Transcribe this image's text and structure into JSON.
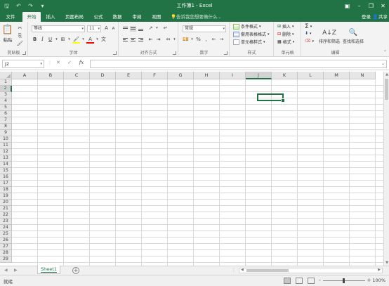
{
  "titlebar": {
    "title": "工作簿1 - Excel",
    "qat": [
      "save-icon",
      "undo-icon",
      "redo-icon",
      "customize-icon"
    ],
    "window_buttons": [
      "ribbon-display-icon",
      "minimize-icon",
      "restore-icon",
      "close-icon"
    ]
  },
  "tabs": {
    "file": "文件",
    "home": "开始",
    "insert": "插入",
    "page_layout": "页面布局",
    "formulas": "公式",
    "data": "数据",
    "review": "审阅",
    "view": "视图",
    "tell_me": "告诉我您想要做什么...",
    "sign_in": "登录",
    "share": "共享"
  },
  "ribbon": {
    "clipboard": {
      "paste": "粘贴",
      "label": "剪贴板"
    },
    "font": {
      "name": "等线",
      "size": "11",
      "label": "字体",
      "bold": "B",
      "italic": "I",
      "underline": "U",
      "font_color_letter": "A",
      "grow": "A",
      "shrink": "A",
      "fill_color": "#ffff00",
      "text_color": "#ff0000"
    },
    "alignment": {
      "label": "对齐方式"
    },
    "number": {
      "format": "常规",
      "label": "数字",
      "percent": "%",
      "comma": ","
    },
    "styles": {
      "conditional": "条件格式",
      "table": "套用表格格式",
      "cell": "单元格样式",
      "label": "样式"
    },
    "cells": {
      "insert": "插入",
      "delete": "删除",
      "format": "格式",
      "label": "单元格"
    },
    "editing": {
      "sum_symbol": "Σ",
      "sort_filter": "排序和筛选",
      "find_select": "查找和选择",
      "label": "编辑"
    }
  },
  "formula_bar": {
    "name_box": "J2",
    "fx": "fx",
    "cancel": "✕",
    "enter": "✓",
    "value": ""
  },
  "grid": {
    "columns": [
      "A",
      "B",
      "C",
      "D",
      "E",
      "F",
      "G",
      "H",
      "I",
      "J",
      "K",
      "L",
      "M",
      "N"
    ],
    "rows": [
      "1",
      "2",
      "3",
      "4",
      "5",
      "6",
      "7",
      "8",
      "9",
      "10",
      "11",
      "12",
      "13",
      "14",
      "15",
      "16",
      "17",
      "18",
      "19",
      "20",
      "21",
      "22",
      "23",
      "24",
      "25",
      "26",
      "27",
      "28",
      "29"
    ],
    "selected_column": "J",
    "selected_row": "2"
  },
  "sheets": {
    "tabs": [
      "Sheet1"
    ],
    "active": "Sheet1",
    "add": "+"
  },
  "status": {
    "ready": "就绪",
    "zoom": "100%",
    "zoom_minus": "-",
    "zoom_plus": "+"
  },
  "colors": {
    "accent": "#217346",
    "header": "#e6e6e6",
    "ribbon": "#f3f3f3"
  }
}
